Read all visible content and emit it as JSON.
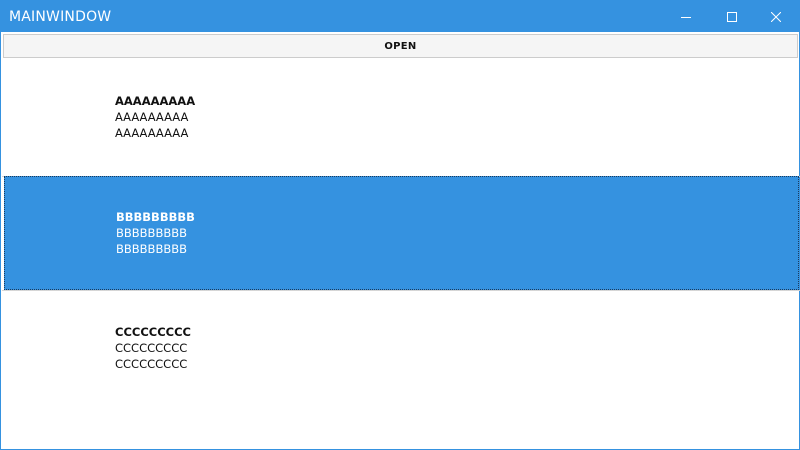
{
  "window": {
    "title": "MAINWINDOW",
    "accent_color": "#3592e0",
    "controls": {
      "minimize_icon": "minimize-icon",
      "maximize_icon": "maximize-icon",
      "close_icon": "close-icon"
    }
  },
  "toolbar": {
    "open_label": "OPEN"
  },
  "list": {
    "selected_index": 1,
    "items": [
      {
        "title": "AAAAAAAAA",
        "line1": "AAAAAAAAA",
        "line2": "AAAAAAAAA"
      },
      {
        "title": "BBBBBBBBB",
        "line1": "BBBBBBBBB",
        "line2": "BBBBBBBBB"
      },
      {
        "title": "CCCCCCCCC",
        "line1": "CCCCCCCCC",
        "line2": "CCCCCCCCC"
      }
    ]
  }
}
